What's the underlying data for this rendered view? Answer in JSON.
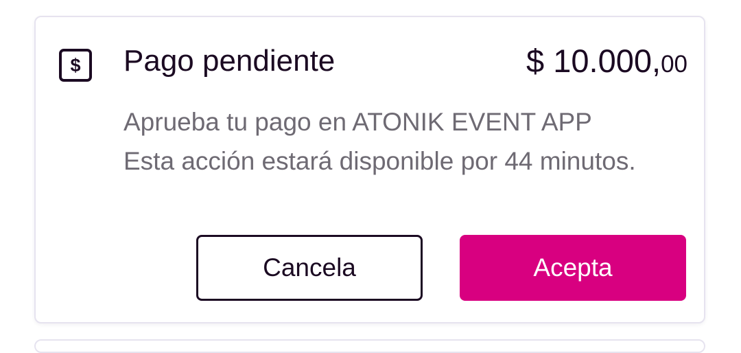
{
  "payment_card": {
    "icon": "dollar-icon",
    "icon_glyph": "$",
    "title": "Pago pendiente",
    "amount_main": "$ 10.000,",
    "amount_cents": "00",
    "description_line1": "Aprueba tu pago en ATONIK EVENT APP",
    "description_line2": "Esta acción estará disponible por 44 minutos.",
    "cancel_label": "Cancela",
    "accept_label": "Acepta"
  },
  "colors": {
    "primary_text": "#1b0a22",
    "secondary_text": "#6e6a73",
    "accent": "#d80080",
    "card_border": "#e6e3ef"
  }
}
